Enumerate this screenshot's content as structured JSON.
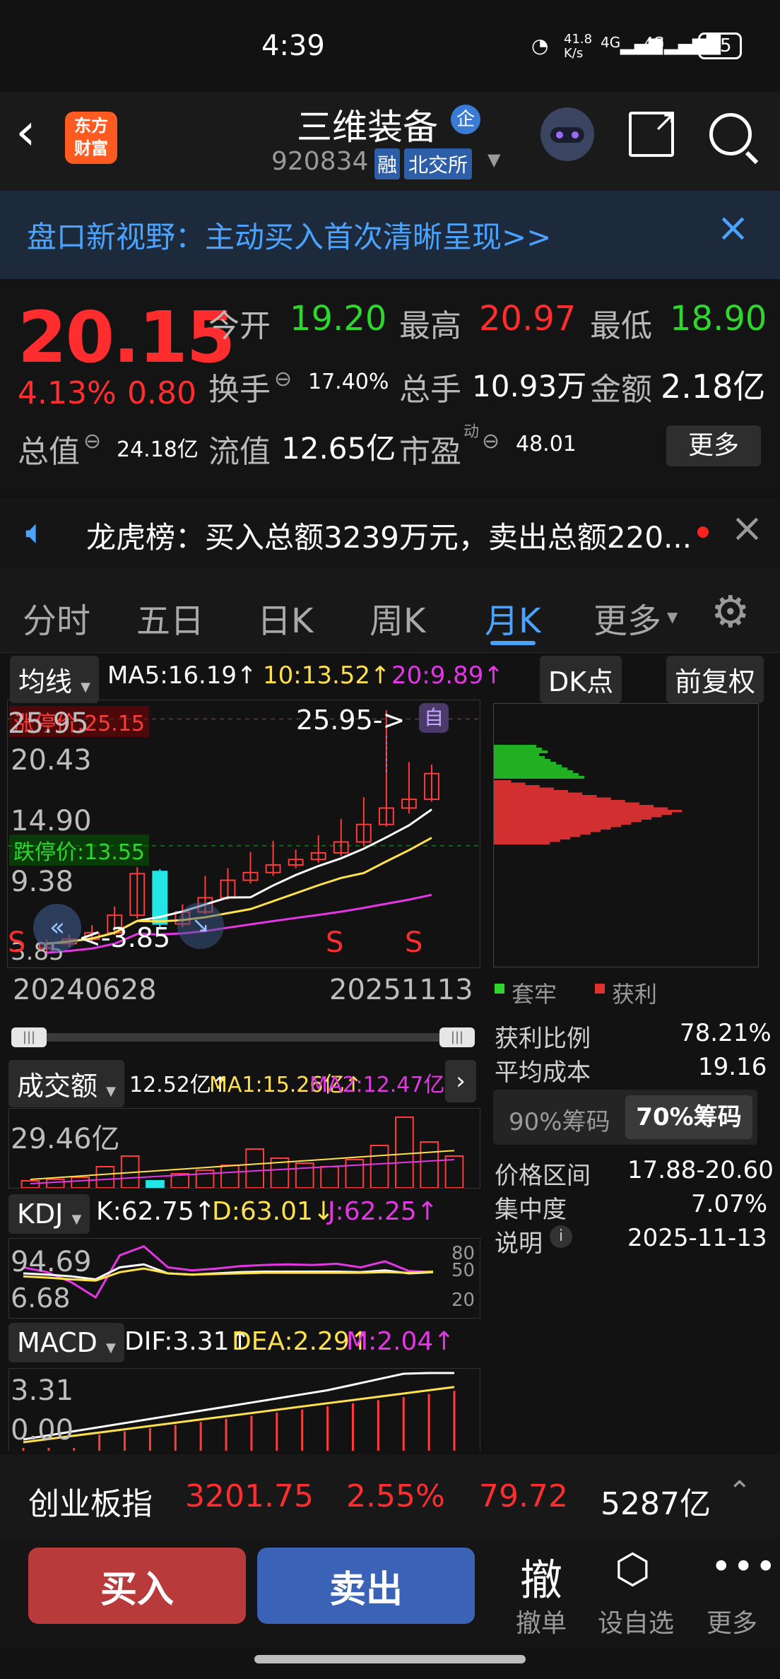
{
  "status": {
    "time": "4:39",
    "net_speed": "41.8\nK/s",
    "sig1": "4G",
    "sig2": "4G",
    "battery": "25"
  },
  "header": {
    "logo_line1": "东方",
    "logo_line2": "财富",
    "stock_name": "三维装备",
    "badge": "企",
    "code": "920834",
    "tag_margin": "融",
    "tag_exchange": "北交所"
  },
  "banner": {
    "text": "盘口新视野：主动买入首次清晰呈现>>"
  },
  "quote": {
    "price": "20.15",
    "change_pct": "4.13%",
    "change_abs": "0.80",
    "open_label": "今开",
    "open": "19.20",
    "high_label": "最高",
    "high": "20.97",
    "low_label": "最低",
    "low": "18.90",
    "turnover_label": "换手",
    "turnover": "17.40%",
    "volume_label": "总手",
    "volume": "10.93万",
    "amount_label": "金额",
    "amount": "2.18亿",
    "mktcap_label": "总值",
    "mktcap": "24.18亿",
    "float_label": "流值",
    "float": "12.65亿",
    "pe_label": "市盈",
    "pe_sup": "动",
    "pe": "48.01",
    "more": "更多"
  },
  "notice": {
    "text": "龙虎榜：买入总额3239万元，卖出总额220..."
  },
  "tabs": [
    "分时",
    "五日",
    "日K",
    "周K",
    "月K",
    "更多"
  ],
  "active_tab": "月K",
  "chart_toolbar": {
    "indicator": "均线",
    "ma5": "MA5:16.19↑",
    "ma10": "10:13.52↑",
    "ma20": "20:9.89↑",
    "dk": "DK点",
    "adjust": "前复权"
  },
  "kline": {
    "limit_up": "涨停价:25.15",
    "limit_down": "跌停价:13.55",
    "max_marker": "25.95->",
    "self_tag": "自",
    "y_labels": [
      "25.95",
      "20.43",
      "14.90",
      "9.38",
      "3.85"
    ],
    "min_marker": "<-3.85",
    "dates": [
      "20240628",
      "20251113"
    ],
    "signals": [
      "S",
      "S",
      "S"
    ]
  },
  "chips": {
    "legend_trap": "套牢",
    "legend_profit": "获利",
    "profit_ratio_label": "获利比例",
    "profit_ratio": "78.21%",
    "avg_cost_label": "平均成本",
    "avg_cost": "19.16",
    "tab90": "90%筹码",
    "tab70": "70%筹码",
    "range_label": "价格区间",
    "range": "17.88-20.60",
    "concentration_label": "集中度",
    "concentration": "7.07%",
    "note_label": "说明",
    "note_date": "2025-11-13"
  },
  "volume": {
    "label": "成交额",
    "val": "12.52亿↑",
    "ma1": "MA1:15.26亿↑",
    "ma2": "MA2:12.47亿↑",
    "ylabel": "29.46亿"
  },
  "kdj": {
    "label": "KDJ",
    "k": "K:62.75↑",
    "d": "D:63.01↓",
    "j": "J:62.25↑",
    "y1": "94.69",
    "y2": "6.68",
    "lvl": [
      "80",
      "50",
      "20"
    ]
  },
  "macd": {
    "label": "MACD",
    "dif": "DIF:3.31↑",
    "dea": "DEA:2.29↑",
    "m": "M:2.04↑",
    "y1": "3.31",
    "y2": "0.00"
  },
  "index_bar": {
    "name": "创业板指",
    "value": "3201.75",
    "pct": "2.55%",
    "chg": "79.72",
    "amount": "5287亿"
  },
  "actions": {
    "buy": "买入",
    "sell": "卖出",
    "cancel_icon": "撤",
    "cancel": "撤单",
    "watch": "设自选",
    "more": "更多"
  },
  "chart_data": {
    "type": "candlestick",
    "x_range": [
      "20240628",
      "20251113"
    ],
    "ylim": [
      3.85,
      25.95
    ],
    "candles": [
      {
        "o": 4.2,
        "c": 4.6,
        "h": 5.0,
        "l": 3.85
      },
      {
        "o": 4.6,
        "c": 5.0,
        "h": 5.4,
        "l": 4.3
      },
      {
        "o": 5.0,
        "c": 5.6,
        "h": 6.3,
        "l": 4.8
      },
      {
        "o": 5.6,
        "c": 7.2,
        "h": 8.0,
        "l": 5.4
      },
      {
        "o": 7.2,
        "c": 11.0,
        "h": 11.6,
        "l": 6.9
      },
      {
        "o": 11.2,
        "c": 6.4,
        "h": 11.4,
        "l": 6.0
      },
      {
        "o": 6.4,
        "c": 7.5,
        "h": 8.2,
        "l": 6.1
      },
      {
        "o": 7.5,
        "c": 8.8,
        "h": 10.8,
        "l": 7.3
      },
      {
        "o": 8.8,
        "c": 10.4,
        "h": 11.5,
        "l": 8.6
      },
      {
        "o": 10.4,
        "c": 11.1,
        "h": 13.0,
        "l": 10.1
      },
      {
        "o": 11.1,
        "c": 11.8,
        "h": 14.0,
        "l": 10.8
      },
      {
        "o": 11.8,
        "c": 12.3,
        "h": 13.2,
        "l": 11.5
      },
      {
        "o": 12.3,
        "c": 12.9,
        "h": 14.5,
        "l": 12.0
      },
      {
        "o": 12.9,
        "c": 13.9,
        "h": 16.0,
        "l": 12.6
      },
      {
        "o": 13.9,
        "c": 15.5,
        "h": 18.0,
        "l": 13.5
      },
      {
        "o": 15.5,
        "c": 17.0,
        "h": 25.95,
        "l": 15.3
      },
      {
        "o": 17.0,
        "c": 17.8,
        "h": 21.2,
        "l": 16.5
      },
      {
        "o": 17.8,
        "c": 20.15,
        "h": 20.97,
        "l": 17.6
      }
    ]
  }
}
